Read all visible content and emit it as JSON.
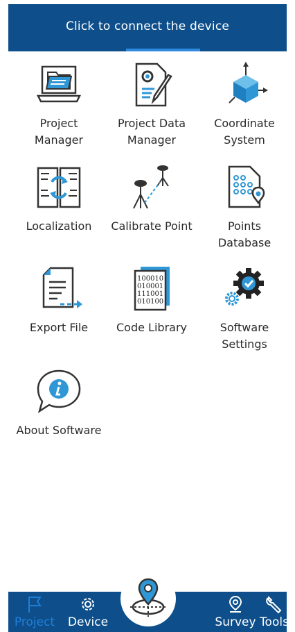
{
  "header": {
    "title": "Click to connect the device"
  },
  "menu": {
    "items": [
      {
        "label": "Project\nManager",
        "icon": "laptop-folder-icon"
      },
      {
        "label": "Project Data\nManager",
        "icon": "document-gear-pencil-icon"
      },
      {
        "label": "Coordinate\nSystem",
        "icon": "cube-axes-icon"
      },
      {
        "label": "Localization",
        "icon": "localization-book-icon"
      },
      {
        "label": "Calibrate Point",
        "icon": "gnss-tripods-icon"
      },
      {
        "label": "Points\nDatabase",
        "icon": "points-database-icon"
      },
      {
        "label": "Export File",
        "icon": "export-file-icon"
      },
      {
        "label": "Code Library",
        "icon": "binary-code-book-icon"
      },
      {
        "label": "Software\nSettings",
        "icon": "gears-check-icon"
      },
      {
        "label": "About Software",
        "icon": "info-speech-bubble-icon"
      }
    ],
    "binary_lines": [
      "100010",
      "010001",
      "111001",
      "010100"
    ]
  },
  "tabbar": {
    "tabs": [
      {
        "label": "Project",
        "icon": "flag-icon",
        "active": true
      },
      {
        "label": "Device",
        "icon": "gear-icon",
        "active": false
      },
      {
        "label": "Survey",
        "icon": "location-pin-icon",
        "active": false
      },
      {
        "label": "Tools",
        "icon": "wrench-icon",
        "active": false
      }
    ],
    "center_icon": "map-target-icon"
  },
  "colors": {
    "brand": "#0e4f8b",
    "accent": "#2e8be0",
    "icon_blue": "#2f97d6",
    "active_tab": "#1f7fd6"
  }
}
